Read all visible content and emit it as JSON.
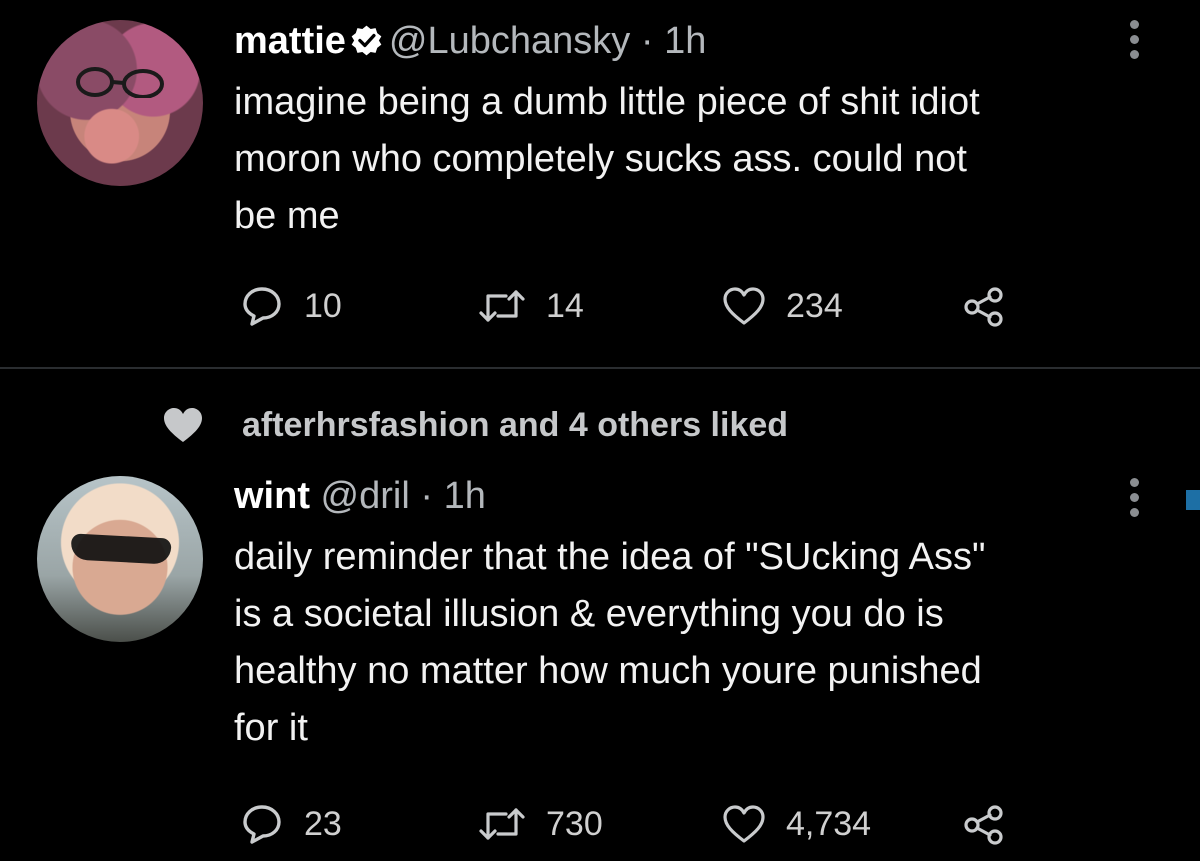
{
  "colors": {
    "background": "#000000",
    "text_primary": "#ffffff",
    "text_secondary": "#b4b8bc",
    "icon": "#c6c8ca",
    "divider": "#2a2d30"
  },
  "tweets": [
    {
      "name": "mattie",
      "verified": true,
      "handle": "@Lubchansky",
      "separator": "·",
      "time": "1h",
      "text_lines": [
        "imagine being a dumb little piece of shit idiot",
        "moron who completely sucks ass. could not",
        "be me"
      ],
      "replies": "10",
      "retweets": "14",
      "likes": "234",
      "icons": {
        "reply": "reply-icon",
        "retweet": "retweet-icon",
        "like": "heart-icon",
        "share": "share-icon",
        "menu": "more-menu-icon"
      }
    },
    {
      "social_context": "afterhrsfashion and 4 others liked",
      "name": "wint",
      "verified": false,
      "handle": "@dril",
      "separator": "·",
      "time": "1h",
      "text_lines": [
        "daily reminder that the idea of \"SUcking Ass\"",
        "is a societal illusion & everything you do is",
        "healthy no matter how much youre punished",
        "for it"
      ],
      "replies": "23",
      "retweets": "730",
      "likes": "4,734",
      "icons": {
        "reply": "reply-icon",
        "retweet": "retweet-icon",
        "like": "heart-icon",
        "share": "share-icon",
        "menu": "more-menu-icon",
        "social_context": "heart-filled-icon"
      }
    }
  ]
}
